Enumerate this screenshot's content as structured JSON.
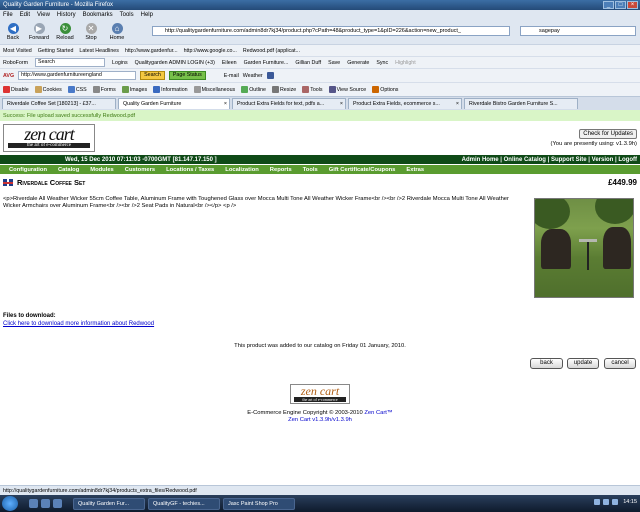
{
  "window": {
    "title": "Quality Garden Furniture - Mozilla Firefox"
  },
  "menu": [
    "File",
    "Edit",
    "View",
    "History",
    "Bookmarks",
    "Tools",
    "Help"
  ],
  "nav": {
    "back": "Back",
    "forward": "Forward",
    "reload": "Reload",
    "stop": "Stop",
    "home": "Home",
    "url": "http://qualitygardenfurniture.com/admin8dr7kj34/product.php?cPath=48&product_type=1&pID=226&action=new_product_",
    "search": "sagepay"
  },
  "bookmarks": [
    "Most Visited",
    "Getting Started",
    "Latest Headlines",
    "http://www.gardenfur...",
    "http://www.google.co...",
    "Redwood.pdf (applicat..."
  ],
  "robo": {
    "roboform": "RoboForm",
    "search": "Search",
    "logins": "Logins",
    "items": [
      "Qualitygarden ADMIN LOGIN (+3)",
      "Eileen",
      "Garden Furniture...",
      "Gillian Duff",
      "Save",
      "Generate",
      "Sync",
      "Highlight"
    ]
  },
  "avg": {
    "label": "AVG",
    "url": "http://www.gardenfurnitureengland",
    "search_btn": "Search",
    "page_status": "Page Status",
    "email": "E-mail",
    "weather": "Weather"
  },
  "dev": [
    "Disable",
    "Cookies",
    "CSS",
    "Forms",
    "Images",
    "Information",
    "Miscellaneous",
    "Outline",
    "Resize",
    "Tools",
    "View Source",
    "Options"
  ],
  "tabs": [
    {
      "label": "Riverdale Coffee Set [180213] - £37...",
      "active": false
    },
    {
      "label": "Quality Garden Furniture",
      "active": true
    },
    {
      "label": "Product Extra Fields for text, pdfs a...",
      "active": false
    },
    {
      "label": "Product Extra Fields, ecommerce s...",
      "active": false
    },
    {
      "label": "Riverdale Bistro Garden Furniture S...",
      "active": false
    }
  ],
  "success": "Success: File upload saved successfully Redwood.pdf",
  "admin": {
    "logo": {
      "brand": "zen cart",
      "tagline": "the art of e-commerce"
    },
    "check_updates": "Check for Updates",
    "using": "(You are presently using: v1.3.9h)",
    "date": "Wed, 15 Dec 2010 07:11:03 -0700GMT [81.147.17.150 ]",
    "header_links": "Admin Home | Online Catalog | Support Site | Version | Logoff",
    "catmenu": [
      "Configuration",
      "Catalog",
      "Modules",
      "Customers",
      "Locations / Taxes",
      "Localization",
      "Reports",
      "Tools",
      "Gift Certificate/Coupons",
      "Extras"
    ]
  },
  "product": {
    "name": "Riverdale Coffee Set",
    "price": "£449.99",
    "description": "<p>Riverdale All Weather Wicker 55cm Coffee Table, Aluminum Frame with Toughened Glass over Mocca Multi Tone All Weather Wicker Frame<br /><br />2 Riverdale Mocca Multi Tone All Weather Wicker Armchairs over Aluminum Frame<br /><br />2 Seat Pads in Natural<br /></p> <p />",
    "files_label": "Files to download:",
    "file_link": "Click here to download more information about Redwood",
    "added": "This product was added to our catalog on Friday 01 January, 2010."
  },
  "buttons": {
    "back": "back",
    "update": "update",
    "cancel": "cancel"
  },
  "footer": {
    "logo_brand": "zen cart",
    "logo_tagline": "the art of e-commerce",
    "line1": "E-Commerce Engine Copyright © 2003-2010",
    "line1_link": "Zen Cart™",
    "line2": "Zen Cart v1.3.9h/v1.3.9h"
  },
  "statusbar": "http://qualitygardenfurniture.com/admin8dr7kj34/products_extra_files/Redwood.pdf",
  "taskbar": {
    "items": [
      "Quality Garden Fur...",
      "QualityGF - techies...",
      "Jasc Paint Shop Pro"
    ],
    "clock": "14:15"
  }
}
